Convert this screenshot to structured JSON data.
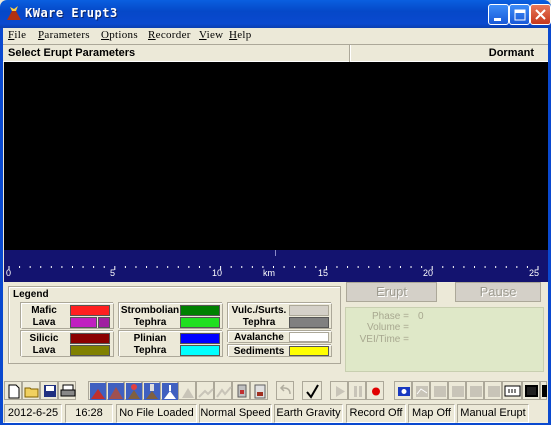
{
  "window": {
    "title": "KWare Erupt3"
  },
  "menu": [
    "File",
    "Parameters",
    "Options",
    "Recorder",
    "View",
    "Help"
  ],
  "header": {
    "title": "Select Erupt Parameters",
    "status": "Dormant"
  },
  "ruler": {
    "ticks": [
      "0",
      "5",
      "10",
      "km",
      "15",
      "20",
      "25"
    ]
  },
  "legend": {
    "title": "Legend",
    "mafic": {
      "label1": "Mafic",
      "label2": "Lava",
      "colors": [
        "#ff2020",
        "#c020c0",
        "#a020a0"
      ]
    },
    "silicic": {
      "label1": "Silicic",
      "label2": "Lava",
      "colors": [
        "#8b0000",
        "#808000"
      ]
    },
    "strombolian": {
      "label1": "Strombolian",
      "label2": "Tephra",
      "colors": [
        "#008000",
        "#20e020"
      ]
    },
    "plinian": {
      "label1": "Plinian",
      "label2": "Tephra",
      "colors": [
        "#0000ff",
        "#00ffff"
      ]
    },
    "vulcanian": {
      "label1": "Vulc./Surts.",
      "label2": "Tephra",
      "colors": [
        "#d4d0c8",
        "#808080"
      ]
    },
    "avalanche": {
      "label": "Avalanche",
      "color": "#ffffff"
    },
    "sediments": {
      "label": "Sediments",
      "color": "#ffff00"
    }
  },
  "controls": {
    "erupt_label": "Erupt",
    "pause_label": "Pause"
  },
  "stats": {
    "phase_label": "Phase =",
    "phase_value": "0",
    "volume_label": "Volume =",
    "vei_label": "VEI/Time ="
  },
  "statusbar": [
    "2012-6-25",
    "16:28",
    "No File Loaded",
    "Normal Speed",
    "Earth Gravity",
    "Record Off",
    "Map Off",
    "Manual Erupt"
  ],
  "colors": {
    "titlebar": "#0a49cf",
    "water": "#13136f",
    "canvas": "#000000",
    "stats_bg": "#dfe8c8"
  }
}
